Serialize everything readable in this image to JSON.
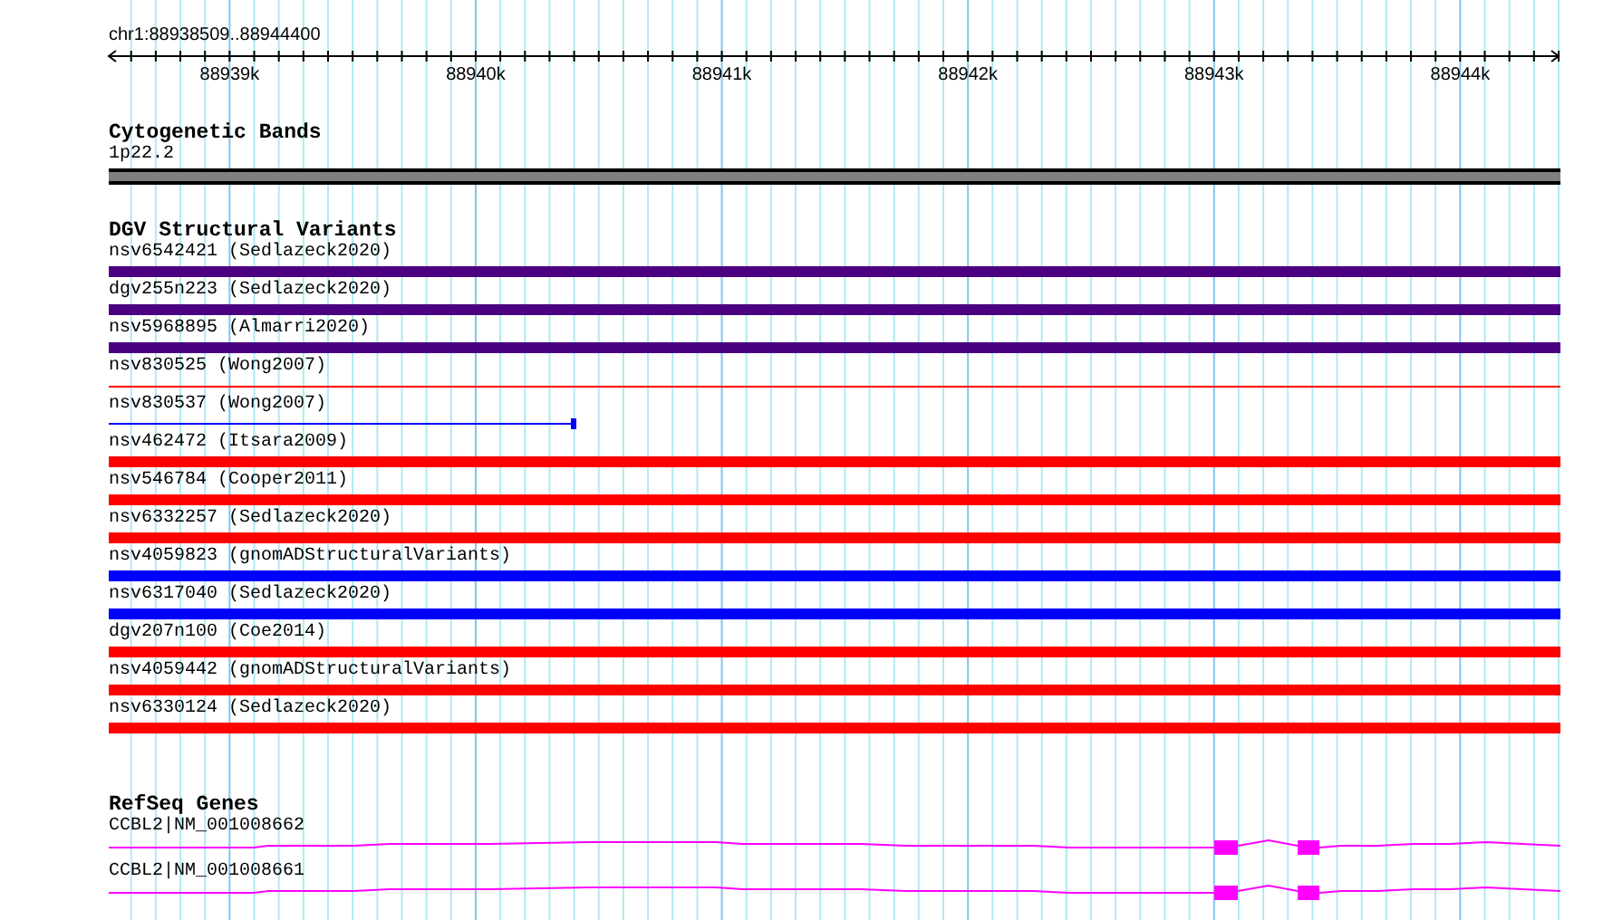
{
  "ruler": {
    "range": "chr1:88938509..88944400",
    "ticks": [
      "88939k",
      "88940k",
      "88941k",
      "88942k",
      "88943k",
      "88944k"
    ]
  },
  "cytogenetic_bands": {
    "title": "Cytogenetic Bands",
    "band": "1p22.2"
  },
  "dgv_variants": {
    "title": "DGV Structural Variants",
    "items": [
      {
        "label": "nsv6542421 (Sedlazeck2020)",
        "kind": "bar",
        "color": "#4b0082"
      },
      {
        "label": "dgv255n223 (Sedlazeck2020)",
        "kind": "bar",
        "color": "#4b0082"
      },
      {
        "label": "nsv5968895 (Almarri2020)",
        "kind": "bar",
        "color": "#4b0082"
      },
      {
        "label": "nsv830525 (Wong2007)",
        "kind": "line",
        "color": "#ff0000"
      },
      {
        "label": "nsv830537 (Wong2007)",
        "kind": "capped-line",
        "color": "#0000ff"
      },
      {
        "label": "nsv462472 (Itsara2009)",
        "kind": "bar",
        "color": "#ff0000"
      },
      {
        "label": "nsv546784 (Cooper2011)",
        "kind": "bar",
        "color": "#ff0000"
      },
      {
        "label": "nsv6332257 (Sedlazeck2020)",
        "kind": "bar",
        "color": "#ff0000"
      },
      {
        "label": "nsv4059823 (gnomADStructuralVariants)",
        "kind": "bar",
        "color": "#0000ff"
      },
      {
        "label": "nsv6317040 (Sedlazeck2020)",
        "kind": "bar",
        "color": "#0000ff"
      },
      {
        "label": "dgv207n100 (Coe2014)",
        "kind": "bar",
        "color": "#ff0000"
      },
      {
        "label": "nsv4059442 (gnomADStructuralVariants)",
        "kind": "bar",
        "color": "#ff0000"
      },
      {
        "label": "nsv6330124 (Sedlazeck2020)",
        "kind": "bar",
        "color": "#ff0000"
      }
    ]
  },
  "refseq_genes": {
    "title": "RefSeq Genes",
    "items": [
      {
        "label": "CCBL2|NM_001008662"
      },
      {
        "label": "CCBL2|NM_001008661"
      }
    ]
  }
}
